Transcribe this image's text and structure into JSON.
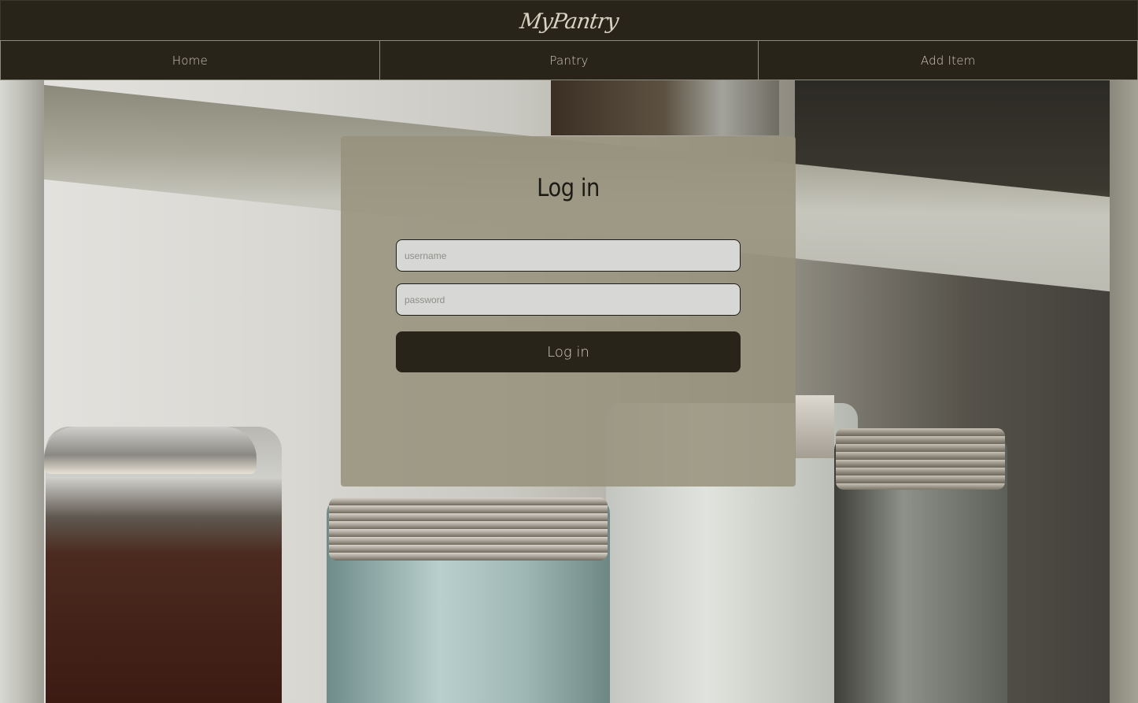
{
  "header": {
    "logo_text": "MyPantry"
  },
  "nav": {
    "items": [
      {
        "label": "Home"
      },
      {
        "label": "Pantry"
      },
      {
        "label": "Add Item"
      }
    ]
  },
  "login": {
    "title": "Log in",
    "username_placeholder": "username",
    "password_placeholder": "password",
    "submit_label": "Log in"
  },
  "background": {
    "description": "pantry-shelf-with-glass-jars"
  },
  "colors": {
    "header_bg": "#28241a",
    "card_bg": "#96917b",
    "button_bg": "#28241a",
    "input_bg": "#d7d7d5",
    "nav_text": "#cfc9ba"
  }
}
